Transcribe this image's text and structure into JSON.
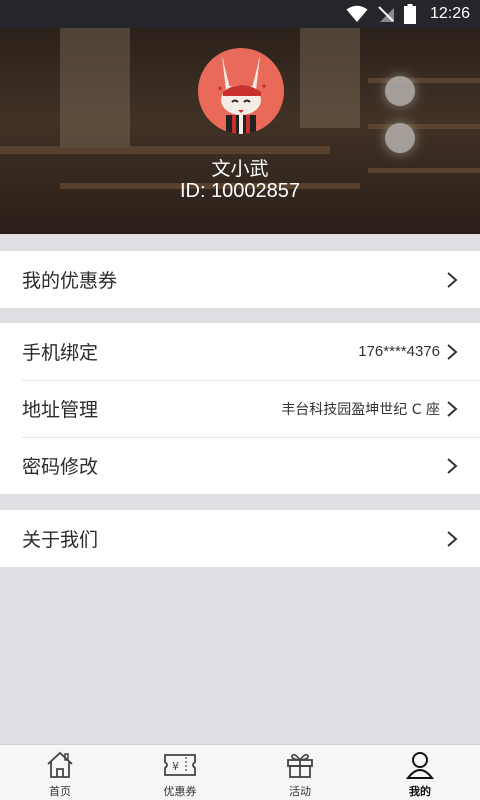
{
  "status_bar": {
    "time": "12:26"
  },
  "profile": {
    "name": "文小武",
    "id": "ID: 10002857"
  },
  "menu": {
    "coupons": {
      "label": "我的优惠券"
    },
    "phone": {
      "label": "手机绑定",
      "value": "176****4376"
    },
    "address": {
      "label": "地址管理",
      "value": "丰台科技园盈坤世纪 C 座"
    },
    "password": {
      "label": "密码修改"
    },
    "about": {
      "label": "关于我们"
    }
  },
  "tabbar": {
    "items": [
      {
        "label": "首页",
        "icon": "home-icon",
        "active": false
      },
      {
        "label": "优惠券",
        "icon": "ticket-icon",
        "active": false
      },
      {
        "label": "活动",
        "icon": "gift-icon",
        "active": false
      },
      {
        "label": "我的",
        "icon": "user-icon",
        "active": true
      }
    ]
  }
}
